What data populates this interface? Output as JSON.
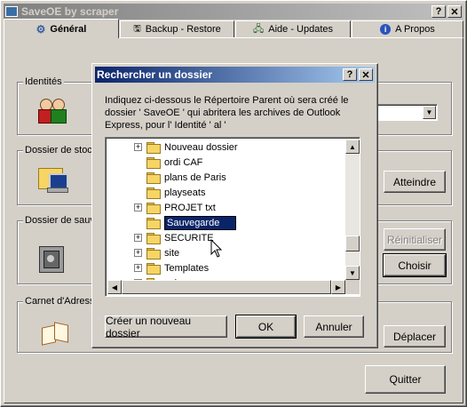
{
  "main_window": {
    "title": "SaveOE by scraper",
    "help_glyph": "?",
    "close_glyph": "✕",
    "tabs": [
      {
        "label": "Général",
        "icon": "gear-icon"
      },
      {
        "label": "Backup - Restore",
        "icon": "backup-icon"
      },
      {
        "label": "Aide - Updates",
        "icon": "help-network-icon"
      },
      {
        "label": "A Propos",
        "icon": "info-icon"
      }
    ],
    "groups": {
      "identites": "Identités",
      "stockage": "Dossier de stoc",
      "sauvegarde": "Dossier de sauv",
      "carnet": "Carnet d'Adress"
    },
    "buttons": {
      "atteindre": "Atteindre",
      "reinitialiser": "Réinitialiser",
      "choisir": "Choisir",
      "deplacer": "Déplacer",
      "quitter": "Quitter"
    }
  },
  "dialog": {
    "title": "Rechercher un dossier",
    "help_glyph": "?",
    "close_glyph": "✕",
    "description_line1": "Indiquez ci-dessous le Répertoire Parent où sera créé le",
    "description_line2": "dossier ' SaveOE ' qui abritera les archives de Outlook",
    "description_line3": "Express, pour l' Identité ' al '",
    "folders": [
      {
        "name": "Nouveau dossier",
        "expander": "+"
      },
      {
        "name": "ordi CAF",
        "expander": ""
      },
      {
        "name": "plans de Paris",
        "expander": ""
      },
      {
        "name": "playseats",
        "expander": ""
      },
      {
        "name": "PROJET txt",
        "expander": "+"
      },
      {
        "name": "Sauvegarde",
        "expander": ""
      },
      {
        "name": "SECURITE",
        "expander": "+"
      },
      {
        "name": "site",
        "expander": "+"
      },
      {
        "name": "Templates",
        "expander": "+"
      },
      {
        "name": "velo",
        "expander": "+"
      }
    ],
    "editing_folder": "Sauvegarde",
    "buttons": {
      "new_folder": "Créer un nouveau dossier",
      "ok": "OK",
      "cancel": "Annuler"
    }
  },
  "colors": {
    "face": "#d4d0c8",
    "title_active_start": "#0a246a",
    "title_active_end": "#a6caf0",
    "title_inactive_start": "#808080",
    "title_inactive_end": "#c0c0c0"
  }
}
